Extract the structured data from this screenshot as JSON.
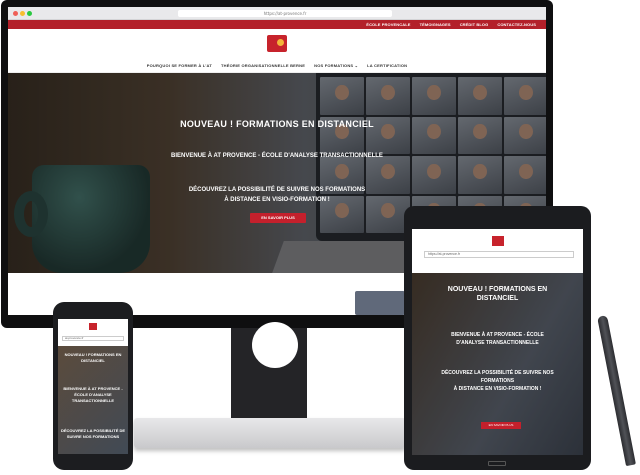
{
  "browser": {
    "url": "https://at-provence.fr"
  },
  "topbar": {
    "links": [
      "ÉCOLE PROVENCALE",
      "TÉMOIGNAGES",
      "CRÉDIT BLOG",
      "CONTACTEZ-NOUS"
    ]
  },
  "nav": {
    "items": [
      "POURQUOI SE FORMER À L'AT",
      "THÉORIE ORGANISATIONNELLE BERNE",
      "NOS FORMATIONS ⌄",
      "LA CERTIFICATION"
    ]
  },
  "hero": {
    "headline": "NOUVEAU ! FORMATIONS EN DISTANCIEL",
    "subtitle": "BIENVENUE À AT PROVENCE - ÉCOLE D'ANALYSE TRANSACTIONNELLE",
    "body_line1": "DÉCOUVREZ LA POSSIBILITÉ DE SUIVRE NOS FORMATIONS",
    "body_line2": "À DISTANCE EN VISIO-FORMATION !",
    "cta": "EN SAVOIR PLUS"
  },
  "phone": {
    "url": "at-provence.fr",
    "lines": [
      "NOUVEAU ! FORMATIONS EN DISTANCIEL",
      "BIENVENUE À AT PROVENCE - ÉCOLE D'ANALYSE TRANSACTIONNELLE",
      "DÉCOUVREZ LA POSSIBILITÉ DE SUIVRE NOS FORMATIONS"
    ]
  },
  "tablet": {
    "url": "https://at-provence.fr",
    "headline1": "NOUVEAU ! FORMATIONS EN",
    "headline2": "DISTANCIEL",
    "sub1": "BIENVENUE À AT PROVENCE - ÉCOLE",
    "sub2": "D'ANALYSE TRANSACTIONNELLE",
    "body1": "DÉCOUVREZ LA POSSIBILITÉ DE SUIVRE NOS",
    "body2": "FORMATIONS",
    "body3": "À DISTANCE EN VISIO-FORMATION !",
    "cta": "EN SAVOIR PLUS"
  },
  "colors": {
    "brand_red": "#c4202c",
    "logo_yellow": "#f3b53a"
  }
}
